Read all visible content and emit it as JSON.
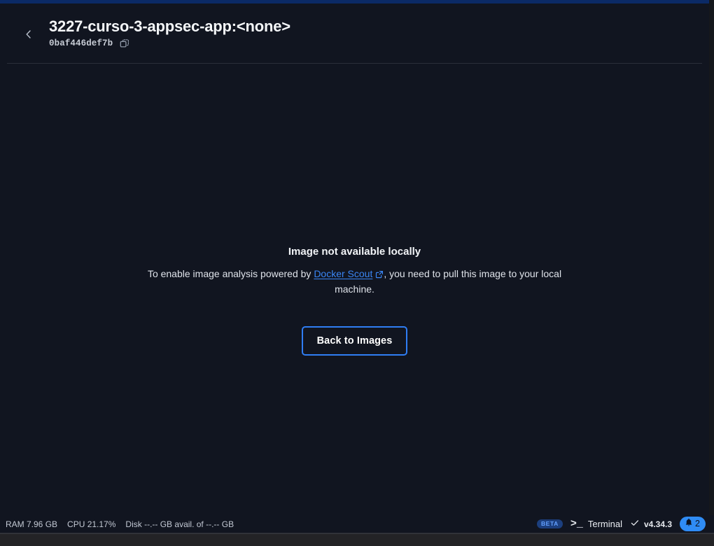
{
  "window": {
    "accent_color": "#0b2a66",
    "background_color": "#111520"
  },
  "header": {
    "back_icon": "chevron-left-icon",
    "image_title": "3227-curso-3-appsec-app:<none>",
    "image_digest": "0baf446def7b",
    "copy_icon": "copy-icon"
  },
  "empty_state": {
    "title": "Image not available locally",
    "description_prefix": "To enable image analysis powered by ",
    "link_label": "Docker Scout",
    "link_icon": "external-link-icon",
    "description_suffix": ", you need to pull this image to your local machine.",
    "button_label": "Back to Images",
    "button_border_color": "#2f7df4",
    "link_color": "#3a86f5"
  },
  "status_bar": {
    "ram": "RAM 7.96 GB",
    "cpu": "CPU 21.17%",
    "disk": "Disk --.-- GB avail. of --.-- GB",
    "beta_badge": "BETA",
    "terminal_icon": ">_",
    "terminal_label": "Terminal",
    "check_icon": "check-icon",
    "version": "v4.34.3",
    "bell_icon": "bell-icon",
    "notification_count": "2",
    "notification_color": "#2f8cf5"
  }
}
